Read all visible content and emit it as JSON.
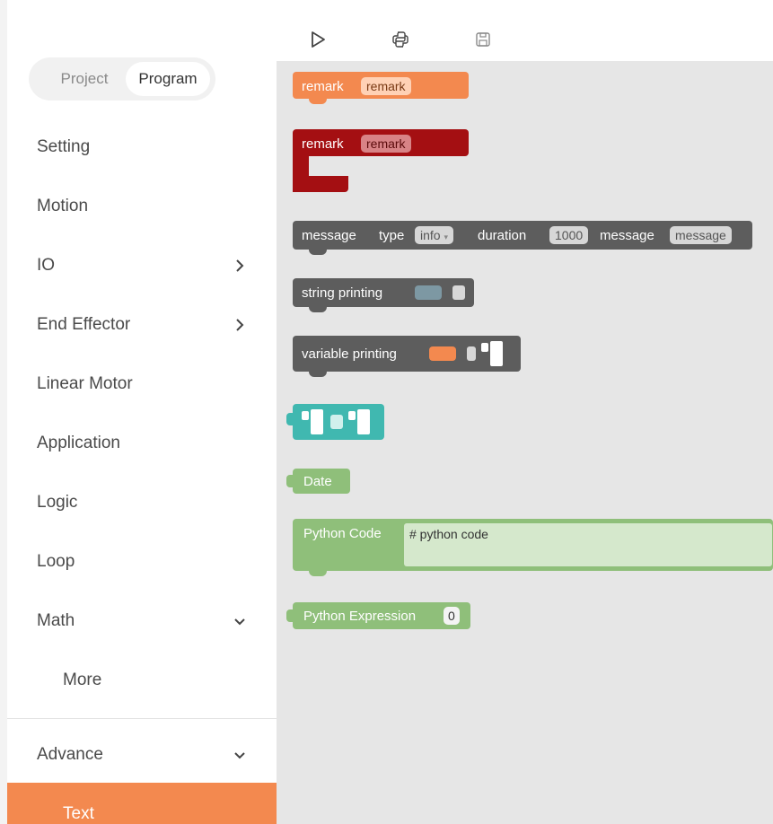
{
  "sidebar": {
    "tabs": {
      "project": "Project",
      "program": "Program"
    },
    "categories": [
      {
        "label": "Setting",
        "chevron": ""
      },
      {
        "label": "Motion",
        "chevron": ""
      },
      {
        "label": "IO",
        "chevron": "right"
      },
      {
        "label": "End Effector",
        "chevron": "right"
      },
      {
        "label": "Linear Motor",
        "chevron": ""
      },
      {
        "label": "Application",
        "chevron": ""
      },
      {
        "label": "Logic",
        "chevron": ""
      },
      {
        "label": "Loop",
        "chevron": ""
      },
      {
        "label": "Math",
        "chevron": "down"
      },
      {
        "label": "More",
        "chevron": ""
      },
      {
        "label": "Advance",
        "chevron": "down"
      },
      {
        "label": "Text",
        "chevron": ""
      }
    ]
  },
  "toolbar": {
    "icons": [
      "play-icon",
      "python-icon",
      "save-icon"
    ]
  },
  "blocks": {
    "remark1": {
      "label": "remark",
      "field": "remark"
    },
    "remark2": {
      "label": "remark",
      "field": "remark"
    },
    "message": {
      "label": "message",
      "type_label": "type",
      "type_value": "info",
      "duration_label": "duration",
      "duration_value": "1000",
      "message_label": "message",
      "message_value": "message"
    },
    "string_printing": {
      "label": "string printing"
    },
    "variable_printing": {
      "label": "variable printing"
    },
    "date": {
      "label": "Date"
    },
    "python_code": {
      "label": "Python Code",
      "code": "# python code"
    },
    "python_expression": {
      "label": "Python Expression",
      "value": "0"
    }
  },
  "colors": {
    "accent": "#f3894f",
    "remark_dark": "#a40f12",
    "block_gray": "#5d5d5d",
    "teal": "#40b8b0",
    "green": "#8fbf7a",
    "workspace_bg": "#e6e6e6"
  }
}
